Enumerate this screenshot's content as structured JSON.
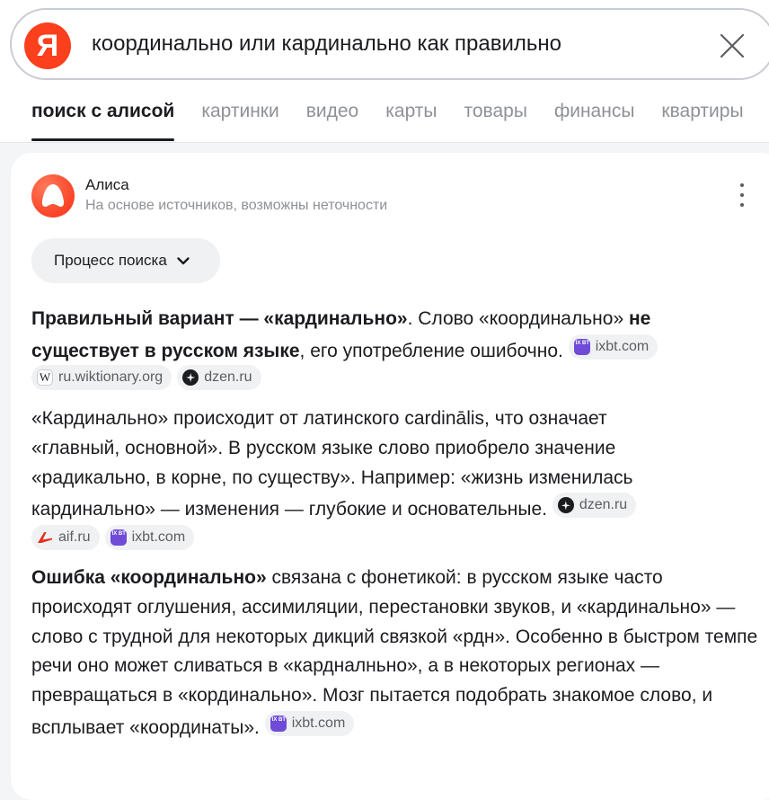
{
  "search": {
    "logo_letter": "Я",
    "query": "координально или кардинально как правильно"
  },
  "tabs": [
    {
      "label": "поиск с алисой",
      "active": true
    },
    {
      "label": "картинки"
    },
    {
      "label": "видео"
    },
    {
      "label": "карты"
    },
    {
      "label": "товары"
    },
    {
      "label": "финансы"
    },
    {
      "label": "квартиры"
    }
  ],
  "alice": {
    "name": "Алиса",
    "subtitle": "На основе источников, возможны неточности",
    "process_button": "Процесс поиска"
  },
  "answer": {
    "p1": {
      "b1": "Правильный вариант — «кардинально»",
      "t1": ". Слово «координально» ",
      "b2": "не существует в русском языке",
      "t2": ", его употребление ошибочно. ",
      "sources": [
        {
          "icon": "ixbt-icon",
          "label": "ixbt.com"
        },
        {
          "icon": "wiktionary-icon",
          "label": "ru.wiktionary.org"
        },
        {
          "icon": "dzen-icon",
          "label": "dzen.ru"
        }
      ]
    },
    "p2": {
      "line1": "«Кардинально» происходит от латинского cardinālis, что означает",
      "line2": "«главный, основной». В русском языке слово приобрело значение",
      "line3": "«радикально, в корне, по существу». Например: «жизнь изменилась",
      "line4": "кардинально» — изменения — глубокие и основательные. ",
      "sources": [
        {
          "icon": "dzen-icon",
          "label": "dzen.ru"
        },
        {
          "icon": "aif-icon",
          "label": "aif.ru"
        },
        {
          "icon": "ixbt-icon",
          "label": "ixbt.com"
        }
      ]
    },
    "p3": {
      "b1": "Ошибка «координально»",
      "t1": " связана с фонетикой: в русском языке часто происходят оглушения, ассимиляции, перестановки звуков, и «кардинально» — слово с трудной для некоторых дикций связкой «рдн». Особенно в быстром темпе речи оно может сливаться в «кардналньно», а в некоторых регионах — превращаться в «кординально». Мозг пытается подобрать знакомое слово, и всплывает «координаты». ",
      "sources": [
        {
          "icon": "ixbt-icon",
          "label": "ixbt.com"
        }
      ]
    }
  },
  "colors": {
    "brand": "#fc3f1d",
    "ixbt": "#6f4bd8",
    "aif": "#e0321f"
  }
}
